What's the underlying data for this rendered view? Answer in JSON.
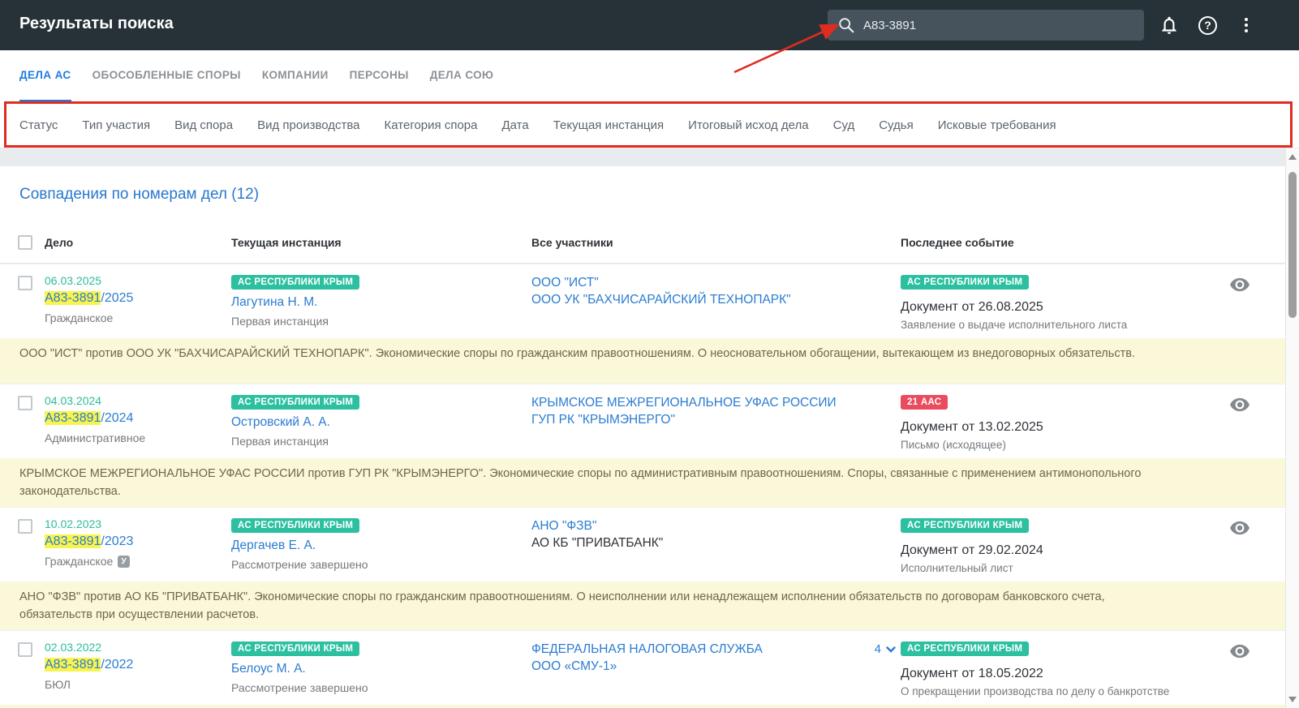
{
  "header": {
    "title": "Результаты поиска",
    "search_value": "А83-3891"
  },
  "tabs": [
    {
      "label": "ДЕЛА АС",
      "active": true
    },
    {
      "label": "ОБОСОБЛЕННЫЕ СПОРЫ",
      "active": false
    },
    {
      "label": "КОМПАНИИ",
      "active": false
    },
    {
      "label": "ПЕРСОНЫ",
      "active": false
    },
    {
      "label": "ДЕЛА СОЮ",
      "active": false
    }
  ],
  "filters": [
    "Статус",
    "Тип участия",
    "Вид спора",
    "Вид производства",
    "Категория спора",
    "Дата",
    "Текущая инстанция",
    "Итоговый исход дела",
    "Суд",
    "Судья",
    "Исковые требования"
  ],
  "results": {
    "section_title": "Совпадения по номерам дел (12)",
    "columns": [
      "Дело",
      "Текущая инстанция",
      "Все участники",
      "Последнее событие"
    ],
    "rows": [
      {
        "date": "06.03.2025",
        "number": "А83-3891",
        "number_suffix": "/2025",
        "type": "Гражданское",
        "type_badge": "",
        "court_badge": "АС РЕСПУБЛИКИ КРЫМ",
        "judge": "Лагутина Н. М.",
        "stage": "Первая инстанция",
        "participant1": "ООО \"ИСТ\"",
        "participant2": "ООО УК \"БАХЧИСАРАЙСКИЙ ТЕХНОПАРК\"",
        "participants_more": "",
        "event_badge": "АС РЕСПУБЛИКИ КРЫМ",
        "event_badge_color": "teal",
        "event_title": "Документ от 26.08.2025",
        "event_subtitle": "Заявление о выдаче исполнительного листа",
        "description": "ООО \"ИСТ\" против ООО УК \"БАХЧИСАРАЙСКИЙ ТЕХНОПАРК\". Экономические споры по гражданским правоотношениям. О неосновательном обогащении, вытекающем из внедоговорных обязательств."
      },
      {
        "date": "04.03.2024",
        "number": "А83-3891",
        "number_suffix": "/2024",
        "type": "Административное",
        "type_badge": "",
        "court_badge": "АС РЕСПУБЛИКИ КРЫМ",
        "judge": "Островский А. А.",
        "stage": "Первая инстанция",
        "participant1": "КРЫМСКОЕ МЕЖРЕГИОНАЛЬНОЕ УФАС РОССИИ",
        "participant2": "ГУП РК \"КРЫМЭНЕРГО\"",
        "participants_more": "",
        "event_badge": "21 ААС",
        "event_badge_color": "red",
        "event_title": "Документ от 13.02.2025",
        "event_subtitle": "Письмо (исходящее)",
        "description": "КРЫМСКОЕ МЕЖРЕГИОНАЛЬНОЕ УФАС РОССИИ против ГУП РК \"КРЫМЭНЕРГО\". Экономические споры по административным правоотношениям. Споры, связанные с применением антимонопольного законодательства."
      },
      {
        "date": "10.02.2023",
        "number": "А83-3891",
        "number_suffix": "/2023",
        "type": "Гражданское",
        "type_badge": "У",
        "court_badge": "АС РЕСПУБЛИКИ КРЫМ",
        "judge": "Дергачев Е. А.",
        "stage": "Рассмотрение завершено",
        "participant1": "АНО \"ФЗВ\"",
        "participant2": "АО КБ \"ПРИВАТБАНК\"",
        "participants_more": "",
        "event_badge": "АС РЕСПУБЛИКИ КРЫМ",
        "event_badge_color": "teal",
        "event_title": "Документ от 29.02.2024",
        "event_subtitle": "Исполнительный лист",
        "description": "АНО \"ФЗВ\" против АО КБ \"ПРИВАТБАНК\". Экономические споры по гражданским правоотношениям. О неисполнении или ненадлежащем исполнении обязательств по договорам банковского счета, обязательств при осуществлении расчетов."
      },
      {
        "date": "02.03.2022",
        "number": "А83-3891",
        "number_suffix": "/2022",
        "type": "БЮЛ",
        "type_badge": "",
        "court_badge": "АС РЕСПУБЛИКИ КРЫМ",
        "judge": "Белоус М. А.",
        "stage": "Рассмотрение завершено",
        "participant1": "ФЕДЕРАЛЬНАЯ НАЛОГОВАЯ СЛУЖБА",
        "participant2": "ООО «СМУ-1»",
        "participants_more": "4",
        "event_badge": "АС РЕСПУБЛИКИ КРЫМ",
        "event_badge_color": "teal",
        "event_title": "Документ от 18.05.2022",
        "event_subtitle": "О прекращении производства по делу о банкротстве",
        "description": ""
      }
    ]
  },
  "icons": {
    "search": "search-icon",
    "bell": "notifications-bell-icon",
    "help": "help-icon",
    "kebab": "kebab-menu-icon",
    "eye": "eye-watch-icon",
    "chevron": "chevron-down-icon"
  },
  "colors": {
    "header_bg": "#263238",
    "accent_blue": "#2b7cd2",
    "active_tab_blue": "#1e7ce0",
    "badge_teal": "#2cc0a1",
    "badge_red": "#ea4b5f",
    "date_teal": "#2bbd9b",
    "highlight_yellow": "#f8f44d",
    "description_bg": "#fbf7d9",
    "annotation_red": "#e02b20"
  }
}
